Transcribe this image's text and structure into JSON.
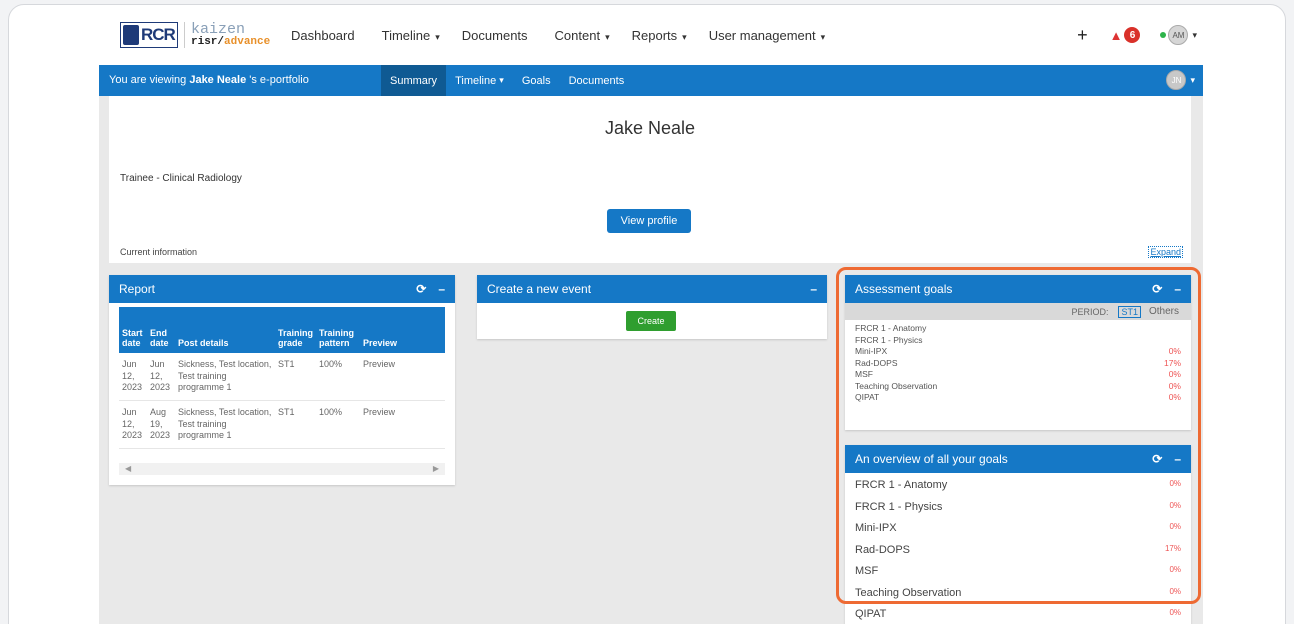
{
  "logo": {
    "rcr": "RCR",
    "kaizen_top": "kaizen",
    "kaizen_bottom_a": "risr/",
    "kaizen_bottom_b": "advance"
  },
  "nav": {
    "items": [
      {
        "label": "Dashboard",
        "caret": ""
      },
      {
        "label": "Timeline",
        "caret": "▾"
      },
      {
        "label": "Documents",
        "caret": ""
      },
      {
        "label": "Content",
        "caret": "▾"
      },
      {
        "label": "Reports",
        "caret": "▾"
      },
      {
        "label": "User management",
        "caret": "▾"
      }
    ],
    "notification_count": "6",
    "user_initials": "AM"
  },
  "portfolio_bar": {
    "viewing_prefix": "You are viewing ",
    "viewing_name": "Jake Neale",
    "viewing_suffix": " 's e-portfolio",
    "tabs": [
      {
        "label": "Summary",
        "caret": ""
      },
      {
        "label": "Timeline",
        "caret": "▾"
      },
      {
        "label": "Goals",
        "caret": ""
      },
      {
        "label": "Documents",
        "caret": ""
      }
    ],
    "trainee_initials": "JN"
  },
  "profile": {
    "name": "Jake Neale",
    "role": "Trainee - Clinical Radiology",
    "view_button": "View profile",
    "current_info": "Current information",
    "expand": "Expand"
  },
  "report": {
    "title": "Report",
    "columns": [
      "Start date",
      "End date",
      "Post details",
      "Training grade",
      "Training pattern",
      "Preview"
    ],
    "rows": [
      [
        "Jun 12, 2023",
        "Jun 12, 2023",
        "Sickness, Test location, Test training programme 1",
        "ST1",
        "100%",
        "Preview"
      ],
      [
        "Jun 12, 2023",
        "Aug 19, 2023",
        "Sickness, Test location, Test training programme 1",
        "ST1",
        "100%",
        "Preview"
      ]
    ]
  },
  "create_event": {
    "title": "Create a new event",
    "button": "Create"
  },
  "assessment_goals": {
    "title": "Assessment goals",
    "period_label": "PERIOD:",
    "period_selected": "ST1",
    "period_other": "Others",
    "goals": [
      {
        "name": "FRCR 1 - Anatomy",
        "pct": ""
      },
      {
        "name": "FRCR 1 - Physics",
        "pct": ""
      },
      {
        "name": "Mini-IPX",
        "pct": "0%"
      },
      {
        "name": "Rad-DOPS",
        "pct": "17%"
      },
      {
        "name": "MSF",
        "pct": "0%"
      },
      {
        "name": "Teaching Observation",
        "pct": "0%"
      },
      {
        "name": "QIPAT",
        "pct": "0%"
      }
    ]
  },
  "overview": {
    "title": "An overview of all your goals",
    "goals": [
      {
        "name": "FRCR 1 - Anatomy",
        "pct": "0%"
      },
      {
        "name": "FRCR 1 - Physics",
        "pct": "0%"
      },
      {
        "name": "Mini-IPX",
        "pct": "0%"
      },
      {
        "name": "Rad-DOPS",
        "pct": "17%"
      },
      {
        "name": "MSF",
        "pct": "0%"
      },
      {
        "name": "Teaching Observation",
        "pct": "0%"
      },
      {
        "name": "QIPAT",
        "pct": "0%"
      }
    ]
  },
  "colors": {
    "primary": "#1578c6",
    "highlight": "#ee6a33",
    "create_green": "#2f9e2f",
    "percent_red": "#e55555"
  }
}
